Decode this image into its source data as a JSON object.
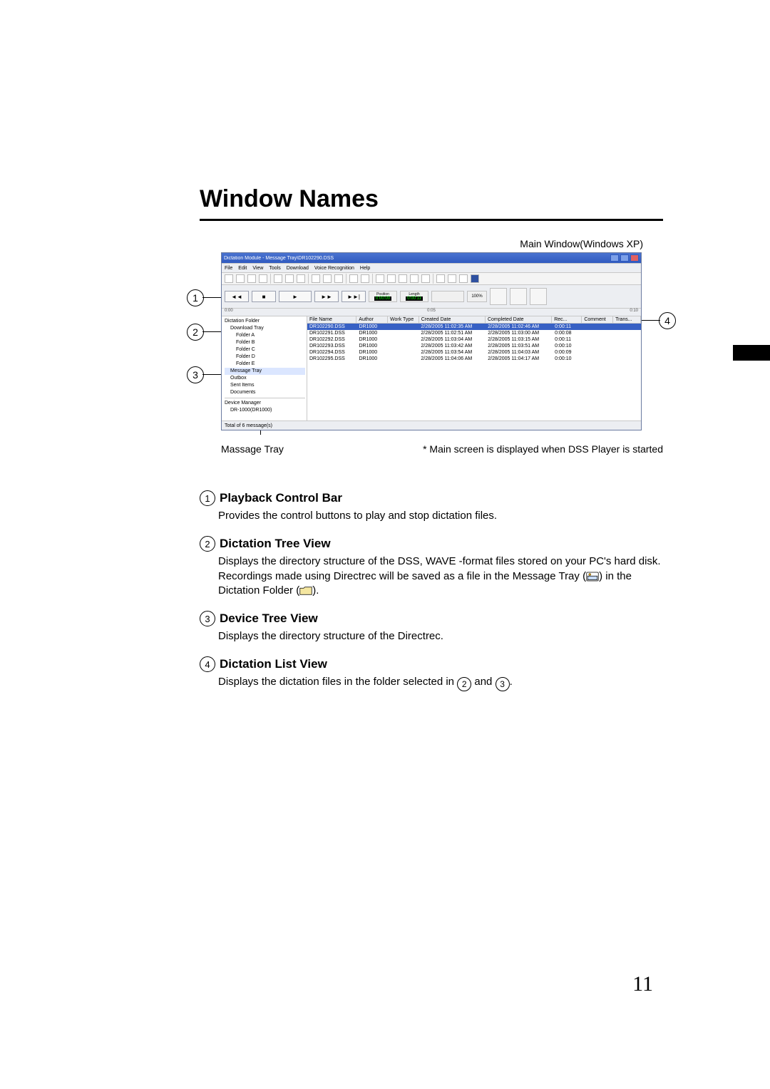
{
  "title": "Window Names",
  "page_number": "11",
  "screenshot": {
    "caption": "Main Window(Windows XP)",
    "footnote": "* Main screen is displayed when DSS Player is started",
    "pointer_label": "Massage Tray",
    "titlebar": "Dictation Module - Message Tray\\DR102290.DSS",
    "menus": [
      "File",
      "Edit",
      "View",
      "Tools",
      "Download",
      "Voice Recognition",
      "Help"
    ],
    "playback": {
      "btn_rewind": "◄◄",
      "btn_stop": "■",
      "btn_play": "►",
      "btn_ff": "►►",
      "btn_skip": "►►|",
      "position_label": "Position",
      "position_value": "0:00:00",
      "length_label": "Length",
      "length_value": "0:00:11",
      "speed": "100%"
    },
    "time_scale": {
      "t0": "0:00",
      "t1": "0:05",
      "t2": "0:10"
    },
    "tree": {
      "root": "Dictation Folder",
      "download": "Download Tray",
      "a": "Folder A",
      "b": "Folder B",
      "c": "Folder C",
      "d": "Folder D",
      "e": "Folder E",
      "message_tray": "Message Tray",
      "outbox": "Outbox",
      "sent_items": "Sent Items",
      "documents": "Documents",
      "device_manager": "Device Manager",
      "device": "DR-1000(DR1000)"
    },
    "columns": {
      "file_name": "File Name",
      "author": "Author",
      "work_type": "Work Type",
      "created_date": "Created Date",
      "completed_date": "Completed Date",
      "rec": "Rec...",
      "comment": "Comment",
      "trans": "Trans..."
    },
    "rows": [
      {
        "file": "DR102290.DSS",
        "author": "DR1000",
        "wt": "",
        "created": "2/28/2005 11:02:35 AM",
        "completed": "2/28/2005 11:02:46 AM",
        "rec": "0:00:11"
      },
      {
        "file": "DR102291.DSS",
        "author": "DR1000",
        "wt": "",
        "created": "2/28/2005 11:02:51 AM",
        "completed": "2/28/2005 11:03:00 AM",
        "rec": "0:00:08"
      },
      {
        "file": "DR102292.DSS",
        "author": "DR1000",
        "wt": "",
        "created": "2/28/2005 11:03:04 AM",
        "completed": "2/28/2005 11:03:15 AM",
        "rec": "0:00:11"
      },
      {
        "file": "DR102293.DSS",
        "author": "DR1000",
        "wt": "",
        "created": "2/28/2005 11:03:42 AM",
        "completed": "2/28/2005 11:03:51 AM",
        "rec": "0:00:10"
      },
      {
        "file": "DR102294.DSS",
        "author": "DR1000",
        "wt": "",
        "created": "2/28/2005 11:03:54 AM",
        "completed": "2/28/2005 11:04:03 AM",
        "rec": "0:00:09"
      },
      {
        "file": "DR102295.DSS",
        "author": "DR1000",
        "wt": "",
        "created": "2/28/2005 11:04:06 AM",
        "completed": "2/28/2005 11:04:17 AM",
        "rec": "0:00:10"
      }
    ],
    "status": "Total of 6 message(s)"
  },
  "defs": {
    "d1": {
      "num": "1",
      "title": "Playback Control Bar",
      "body": "Provides the control buttons to play and stop dictation files."
    },
    "d2": {
      "num": "2",
      "title": "Dictation Tree View",
      "body_a": "Displays the directory structure of the DSS, WAVE -format files stored on your PC's hard disk.",
      "body_b": "Recordings made using Directrec will be saved as a file in the Message Tray (",
      "body_c": ") in the Dictation Folder (",
      "body_d": ")."
    },
    "d3": {
      "num": "3",
      "title": "Device Tree View",
      "body": "Displays the directory structure of the Directrec."
    },
    "d4": {
      "num": "4",
      "title": "Dictation List View",
      "body_a": "Displays the dictation files in the folder selected in ",
      "body_b": " and ",
      "body_c": ".",
      "ref2": "2",
      "ref3": "3"
    }
  }
}
